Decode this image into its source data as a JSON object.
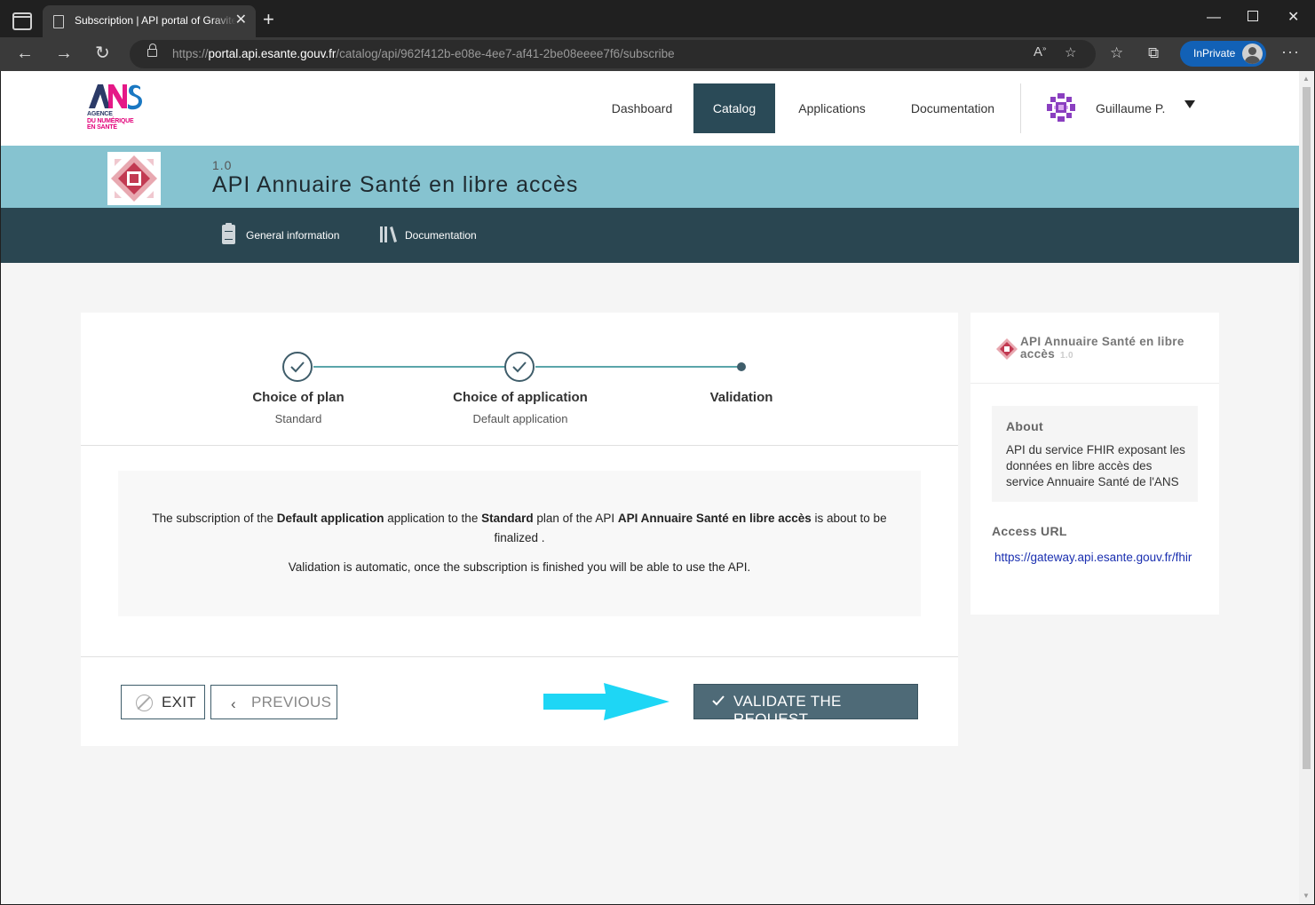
{
  "browser": {
    "tab_title": "Subscription | API portal of Gravitee",
    "tab_close": "✕",
    "new_tab": "+",
    "url_prefix": "https://",
    "url_host": "portal.api.esante.gouv.fr",
    "url_path": "/catalog/api/962f412b-e08e-4ee7-af41-2be08eeee7f6/subscribe",
    "inprivate_label": "InPrivate"
  },
  "header": {
    "logo_lines": [
      "AGENCE",
      "DU NUMÉRIQUE",
      "EN SANTÉ"
    ],
    "nav": [
      {
        "label": "Dashboard",
        "active": false
      },
      {
        "label": "Catalog",
        "active": true
      },
      {
        "label": "Applications",
        "active": false
      },
      {
        "label": "Documentation",
        "active": false
      }
    ],
    "user_name": "Guillaume P."
  },
  "api": {
    "version": "1.0",
    "title": "API Annuaire Santé en libre accès",
    "subnav": {
      "general": "General information",
      "documentation": "Documentation"
    }
  },
  "stepper": {
    "steps": [
      {
        "title": "Choice of plan",
        "subtitle": "Standard",
        "state": "done"
      },
      {
        "title": "Choice of application",
        "subtitle": "Default application",
        "state": "done"
      },
      {
        "title": "Validation",
        "subtitle": "",
        "state": "current"
      }
    ]
  },
  "message": {
    "p1_a": "The subscription of the ",
    "p1_app": "Default application",
    "p1_b": " application to the ",
    "p1_plan": "Standard",
    "p1_c": " plan of the API ",
    "p1_api": "API Annuaire Santé en libre accès",
    "p1_d": " is about to be finalized .",
    "p2": "Validation is automatic, once the subscription is finished you will be able to use the API."
  },
  "actions": {
    "exit": "EXIT",
    "previous": "PREVIOUS",
    "validate": "VALIDATE THE REQUEST"
  },
  "sidebar": {
    "title": "API Annuaire Santé en libre accès",
    "version": "1.0",
    "about_label": "About",
    "about_text": "API du service FHIR exposant les données en libre accès des service Annuaire Santé de l'ANS",
    "access_label": "Access URL",
    "access_url": "https://gateway.api.esante.gouv.fr/fhir"
  },
  "colors": {
    "banner": "#86c3d0",
    "subnav": "#2a4651",
    "primary_button": "#4e6a77",
    "arrow": "#1ed6f5"
  }
}
